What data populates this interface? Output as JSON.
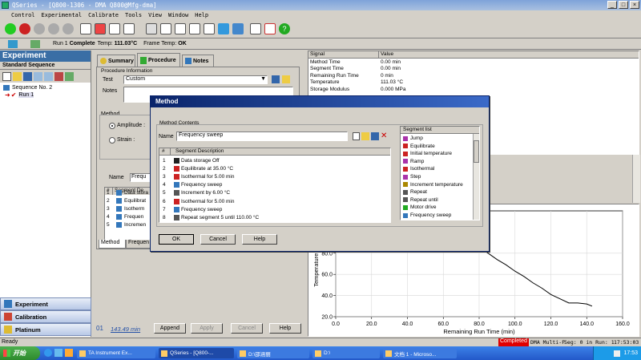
{
  "window": {
    "title": "QSeries - [Q800-1306 - DMA Q800@Mfg-dma]"
  },
  "menu": [
    "Control",
    "Experimental",
    "Calibrate",
    "Tools",
    "View",
    "Window",
    "Help"
  ],
  "status_strip": {
    "run_label": "Run 1",
    "run_state": "Complete",
    "temp_label": "Temp:",
    "temp_value": "111.03°C",
    "frame_label": "Frame Temp:",
    "frame_value": "OK"
  },
  "left_panel": {
    "title": "Experiment",
    "subtitle": "Standard Sequence",
    "tree": [
      "Sequence No. 2",
      "Run 1"
    ],
    "nav": [
      "Experiment",
      "Calibration",
      "Platinum"
    ]
  },
  "center_panel": {
    "tabs": [
      "Summary",
      "Procedure",
      "Notes"
    ],
    "group_title": "Procedure Information",
    "test_label": "Test",
    "test_value": "Custom",
    "notes_label": "Notes",
    "method_label": "Method",
    "amplitude_label": "Amplitude :",
    "strain_label": "Strain :",
    "name_label": "Name",
    "name_value": "Frequ",
    "col_num": "#",
    "col_desc": "Segment De",
    "rows": [
      {
        "n": "1",
        "t": "Data stora"
      },
      {
        "n": "2",
        "t": "Equilibrat"
      },
      {
        "n": "3",
        "t": "Isotherm"
      },
      {
        "n": "4",
        "t": "Frequen"
      },
      {
        "n": "5",
        "t": "Incremen"
      }
    ],
    "bottom_tabs": [
      "Method",
      "Frequen"
    ],
    "footer_num": "01",
    "footer_time": "143.49 min",
    "append": "Append",
    "apply": "Apply",
    "cancel": "Cancel",
    "help": "Help"
  },
  "signal_table": {
    "col_signal": "Signal",
    "col_value": "Value",
    "rows": [
      {
        "s": "Method Time",
        "v": "0.00 min"
      },
      {
        "s": "Segment Time",
        "v": "0.00 min"
      },
      {
        "s": "Remaining Run Time",
        "v": "0 min"
      },
      {
        "s": "Temperature",
        "v": "111.03 °C"
      },
      {
        "s": "Storage Modulus",
        "v": "0.000 MPa"
      }
    ]
  },
  "dialog": {
    "title": "Method",
    "contents_label": "Method Contents",
    "name_label": "Name",
    "name_value": "Frequency sweep",
    "col_num": "#",
    "col_desc": "Segment Description",
    "segments": [
      {
        "n": "1",
        "t": "Data storage   Off"
      },
      {
        "n": "2",
        "t": "Equilibrate at 35.00 °C"
      },
      {
        "n": "3",
        "t": "Isothermal for 5.00 min"
      },
      {
        "n": "4",
        "t": "Frequency sweep"
      },
      {
        "n": "5",
        "t": "Increment by 6.00 °C"
      },
      {
        "n": "6",
        "t": "Isothermal for 5.00 min"
      },
      {
        "n": "7",
        "t": "Frequency sweep"
      },
      {
        "n": "8",
        "t": "Repeat segment 5 until 110.00 °C"
      }
    ],
    "segment_list_title": "Segment list",
    "segment_list": [
      "Jump",
      "Equilibrate",
      "Initial temperature",
      "Ramp",
      "Isothermal",
      "Step",
      "Increment temperature",
      "Repeat",
      "Repeat until",
      "Motor drive",
      "Frequency sweep"
    ],
    "ok": "OK",
    "cancel": "Cancel",
    "help": "Help"
  },
  "chart_data": {
    "type": "line",
    "xlabel": "Remaining Run Time (min)",
    "ylabel": "Temperature (°C)",
    "xlim": [
      0,
      160
    ],
    "ylim": [
      20,
      120
    ],
    "xticks": [
      "0.0",
      "20.0",
      "40.0",
      "60.0",
      "80.0",
      "100.0",
      "120.0",
      "140.0",
      "160.0"
    ],
    "yticks": [
      "20.0",
      "40.0",
      "60.0",
      "80.0"
    ],
    "series": [
      {
        "x": [
          0,
          2,
          4,
          6,
          8,
          10,
          12,
          14,
          16,
          20,
          30,
          40,
          50,
          55,
          60,
          65,
          70,
          75,
          80,
          85,
          90,
          95,
          100,
          105,
          110,
          115,
          120,
          125,
          130,
          135,
          140,
          143
        ],
        "y": [
          111,
          111,
          111,
          111,
          111,
          111,
          111,
          111,
          111,
          111,
          111,
          111,
          111,
          111,
          108,
          102,
          96,
          92,
          86,
          80,
          74,
          69,
          63,
          58,
          52,
          47,
          41,
          37,
          33,
          33,
          32,
          30
        ]
      }
    ]
  },
  "statusbar": {
    "ready": "Ready",
    "completed": "Completed",
    "instrument": "DMA Multi-F",
    "seg": "Seg: 0 in Run: 1",
    "time": "17:53:03"
  },
  "taskbar": {
    "start": "开始",
    "items": [
      "TA Instrument Ex...",
      "QSeries - [Q800-...",
      "D:\\邵涵丽",
      "D:\\",
      "文档 1 - Microso..."
    ],
    "clock": "17:53"
  }
}
